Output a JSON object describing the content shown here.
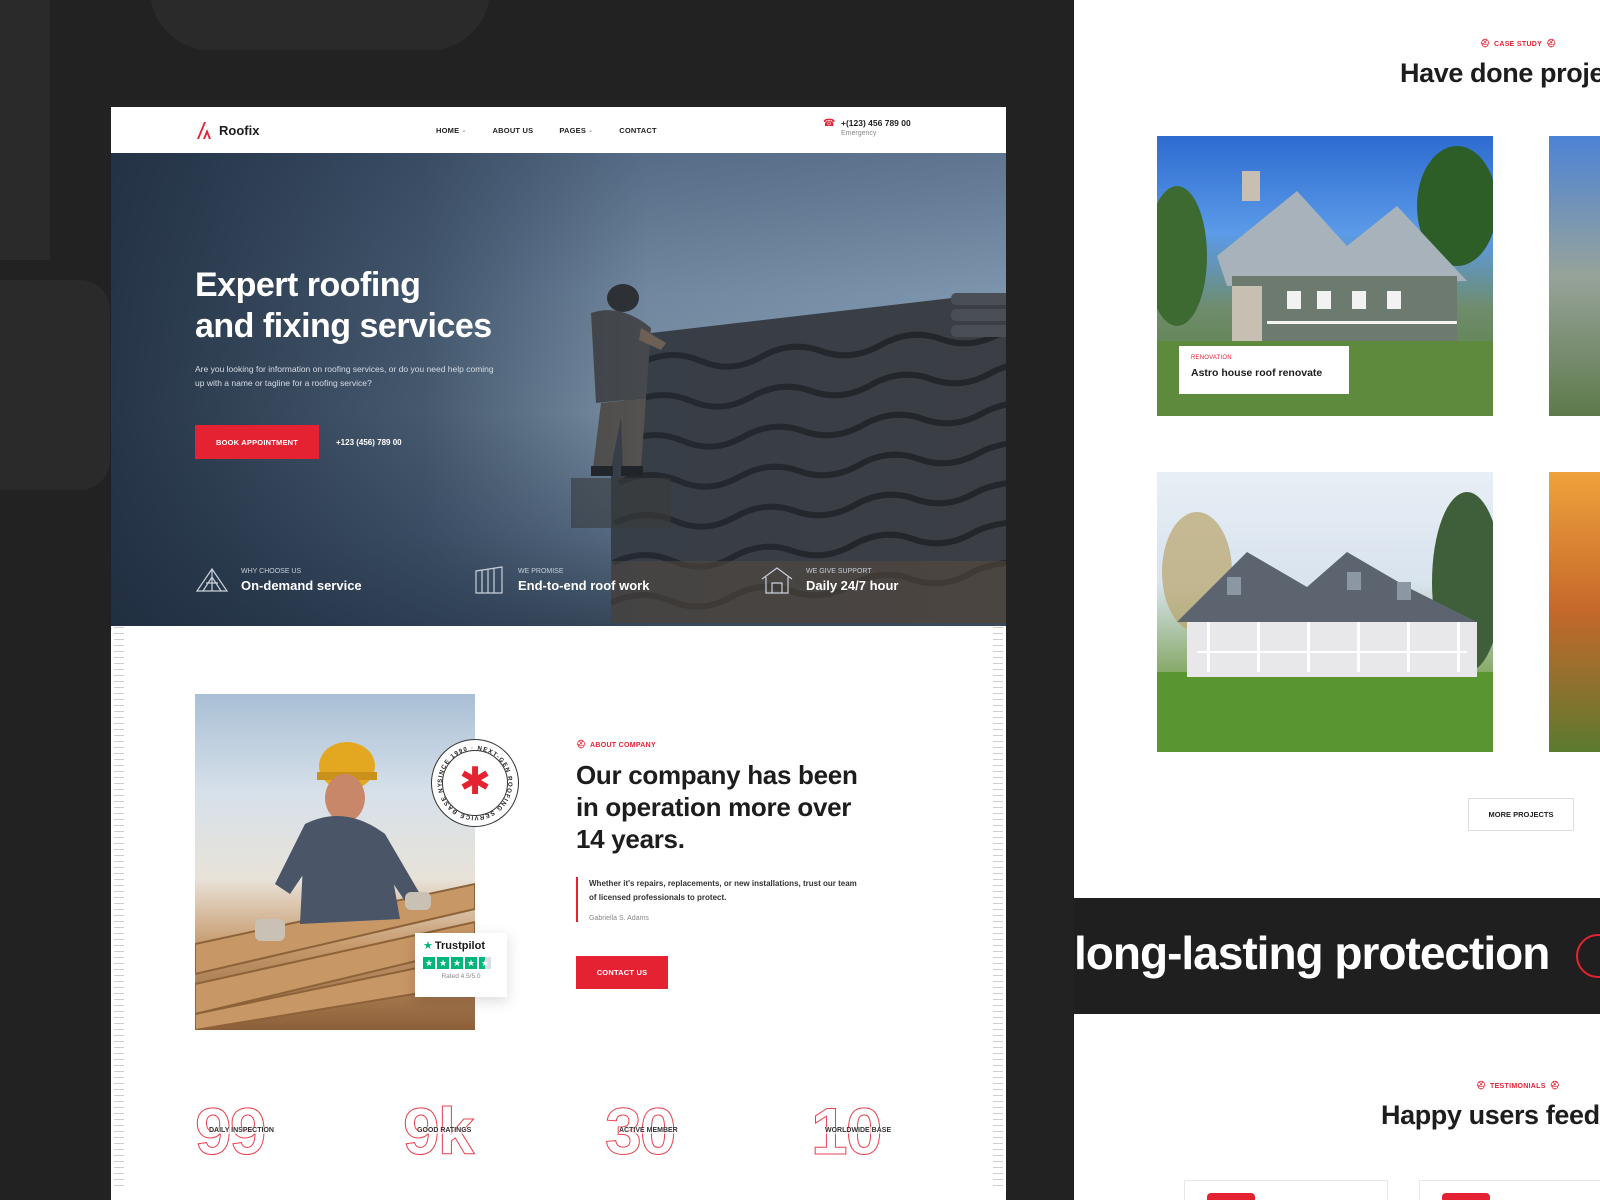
{
  "brand": {
    "name": "Roofix",
    "accent": "#e52232"
  },
  "nav": {
    "items": [
      {
        "label": "HOME",
        "dropdown": true
      },
      {
        "label": "ABOUT US",
        "dropdown": false
      },
      {
        "label": "PAGES",
        "dropdown": true
      },
      {
        "label": "CONTACT",
        "dropdown": false
      }
    ],
    "phone": "+(123) 456 789 00",
    "phone_sub": "Emergency"
  },
  "hero": {
    "title_line1": "Expert roofing",
    "title_line2": "and fixing services",
    "description": "Are you looking for information on roofing services, or do you need help coming up with a name or tagline for a roofing service?",
    "cta": "BOOK APPOINTMENT",
    "phone": "+123 (456) 789 00",
    "features": [
      {
        "label": "WHY CHOOSE US",
        "title": "On-demand service",
        "icon": "roof-truss-icon"
      },
      {
        "label": "WE PROMISE",
        "title": "End-to-end roof work",
        "icon": "roof-panel-icon"
      },
      {
        "label": "WE GIVE SUPPORT",
        "title": "Daily 24/7 hour",
        "icon": "house-frame-icon"
      }
    ]
  },
  "about": {
    "eyebrow": "ABOUT COMPANY",
    "title": "Our company has been in operation more over 14 years.",
    "quote": "Whether it's repairs, replacements, or new installations, trust our team of licensed professionals to protect.",
    "author": "Gabriella S. Adams",
    "cta": "CONTACT US",
    "badge_text": "SINCE 1990 · NEXT-GEN ROOFING SERVICE BASE NYC ·",
    "trustpilot": {
      "name": "Trustpilot",
      "rated": "Rated 4.5/5.0",
      "rating": 4.5
    }
  },
  "stats": [
    {
      "value": "99",
      "label": "DAILY INSPECTION"
    },
    {
      "value": "9k",
      "label": "GOOD RATINGS"
    },
    {
      "value": "30",
      "label": "ACTIVE MEMBER"
    },
    {
      "value": "10",
      "label": "WORLDWIDE BASE"
    }
  ],
  "projects": {
    "eyebrow": "CASE STUDY",
    "title": "Have done proje",
    "featured": {
      "category": "RENOVATION",
      "name": "Astro house roof renovate"
    },
    "more_button": "MORE PROJECTS"
  },
  "marquee": {
    "text": "long-lasting protection"
  },
  "testimonials": {
    "eyebrow": "TESTIMONIALS",
    "title": "Happy users feed"
  }
}
